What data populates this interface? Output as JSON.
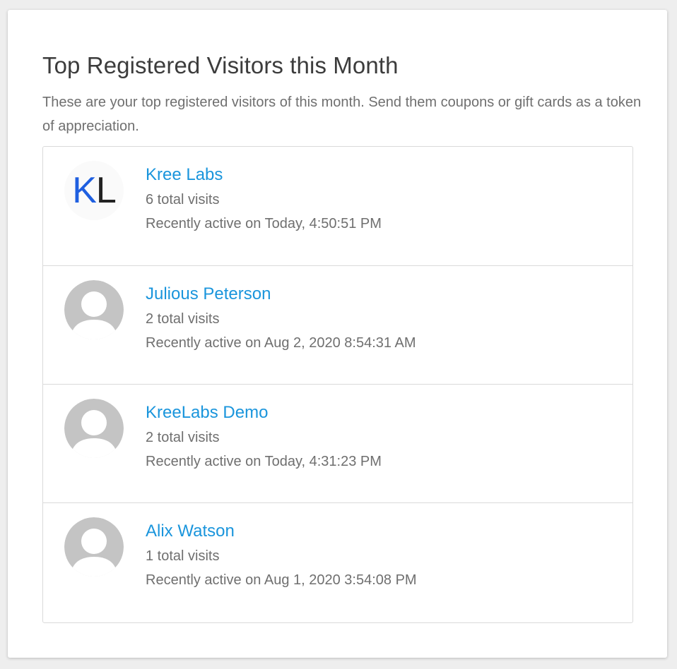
{
  "panel": {
    "title": "Top Registered Visitors this Month",
    "description": "These are your top registered visitors of this month. Send them coupons or gift cards as a token of appreciation."
  },
  "colors": {
    "link": "#1a95dc",
    "text_muted": "#6f6f6f",
    "title": "#3c3c3c",
    "placeholder_avatar": "#c4c4c4",
    "logo_k": "#1f5fe0"
  },
  "visitors": [
    {
      "name": "Kree Labs",
      "visits": "6 total visits",
      "last_active": "Recently active on Today, 4:50:51 PM",
      "avatar": {
        "type": "logo",
        "letter_1": "K",
        "letter_2": "L"
      }
    },
    {
      "name": "Julious Peterson",
      "visits": "2 total visits",
      "last_active": "Recently active on Aug 2, 2020 8:54:31 AM",
      "avatar": {
        "type": "placeholder",
        "icon": "user-silhouette-icon"
      }
    },
    {
      "name": "KreeLabs Demo",
      "visits": "2 total visits",
      "last_active": "Recently active on Today, 4:31:23 PM",
      "avatar": {
        "type": "placeholder",
        "icon": "user-silhouette-icon"
      }
    },
    {
      "name": "Alix Watson",
      "visits": "1 total visits",
      "last_active": "Recently active on Aug 1, 2020 3:54:08 PM",
      "avatar": {
        "type": "placeholder",
        "icon": "user-silhouette-icon"
      }
    }
  ]
}
